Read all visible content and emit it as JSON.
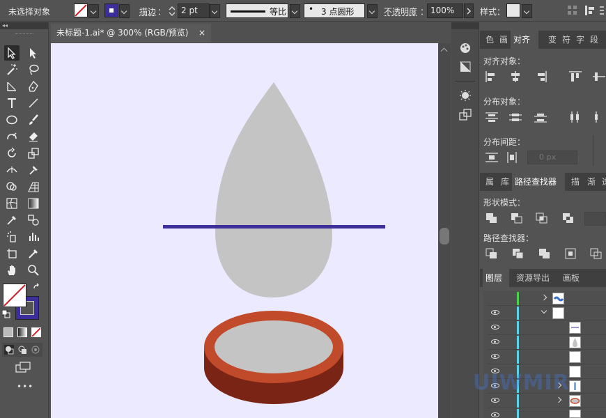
{
  "control_bar": {
    "selection_status": "未选择对象",
    "stroke_label": "描边",
    "stroke_colon": "：",
    "stroke_weight": "2 pt",
    "line_style_label": "等比",
    "brush_label": "3 点圆形",
    "opacity_label": "不透明度",
    "opacity_colon": "：",
    "opacity_value": "100%",
    "style_label": "样式",
    "style_colon": "：",
    "fill_color": "#ffffff",
    "stroke_color": "#3c2f9a"
  },
  "document": {
    "tab_title": "未标题-1.ai* @ 300% (RGB/预览)",
    "close_glyph": "×",
    "canvas_color": "#eceaff"
  },
  "artwork": {
    "drop_color": "#c4c4c4",
    "line_color": "#3c2f9a",
    "dish_rim_color": "#c14a2a",
    "dish_side_color": "#7a2416",
    "dish_inner_color": "#c4c4c4"
  },
  "toolbar": {
    "more_glyph": "•••"
  },
  "panels": {
    "top_tabs": [
      "色",
      "画",
      "对齐",
      "变",
      "符",
      "字",
      "段"
    ],
    "align_objects_label": "对齐对象：",
    "distribute_objects_label": "分布对象：",
    "distribute_spacing_label": "分布间距：",
    "spacing_value": "0 px",
    "mid_tabs": [
      "属",
      "库",
      "路径查找器",
      "描",
      "渐",
      "透"
    ],
    "shape_modes_label": "形状模式：",
    "pathfinder_label": "路径查找器：",
    "layer_tabs": [
      "图层",
      "资源导出",
      "画板"
    ],
    "watermark": "UIWMIR"
  }
}
